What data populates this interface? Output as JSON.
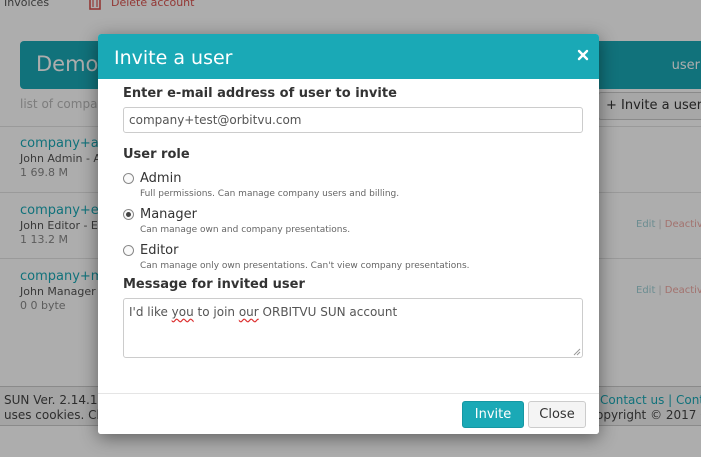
{
  "top_nav": {
    "invoices_label": "Invoices",
    "delete_account_label": "Delete account"
  },
  "background": {
    "banner_title": "Demo",
    "banner_right": "user",
    "list_label": "list of compa",
    "invite_button_label": "+ Invite a user",
    "companies": [
      {
        "link": "company+a",
        "user": "John Admin - A",
        "stats": "1  69.8 M"
      },
      {
        "link": "company+e",
        "user": "John Editor - E",
        "stats": "1  13.2 M"
      },
      {
        "link": "company+m",
        "user": "John Manager",
        "stats": "0  0 byte"
      }
    ],
    "row_actions": {
      "edit": "Edit",
      "separator": "|",
      "deactivate": "Deactiv"
    },
    "footer": {
      "version": "SUN Ver. 2.14.1",
      "cookies": "uses cookies. Ch",
      "contact": "Contact us  |  Conta",
      "copyright": "opyright © 2017  O"
    }
  },
  "modal": {
    "title": "Invite a user",
    "close_icon": "close-icon",
    "email_label": "Enter e-mail address of user to invite",
    "email_value": "company+test@orbitvu.com",
    "role_label": "User role",
    "roles": [
      {
        "label": "Admin",
        "description": "Full permissions. Can manage company users and billing.",
        "checked": false
      },
      {
        "label": "Manager",
        "description": "Can manage own and company presentations.",
        "checked": true
      },
      {
        "label": "Editor",
        "description": "Can manage only own presentations. Can't view company presentations.",
        "checked": false
      }
    ],
    "message_label": "Message for invited user",
    "message_parts": [
      "I'd like ",
      "you",
      " to join ",
      "our",
      " ORBITVU SUN account"
    ],
    "invite_button": "Invite",
    "close_button": "Close",
    "accent_color": "#1aa9b6"
  }
}
